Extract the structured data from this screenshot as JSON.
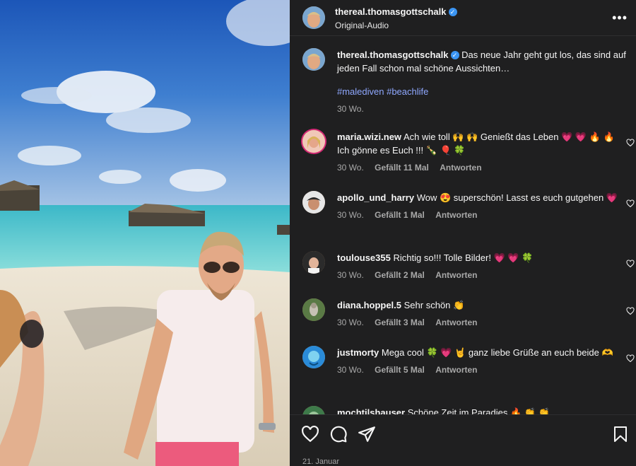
{
  "header": {
    "username": "thereal.thomasgottschalk",
    "subtitle": "Original-Audio",
    "more_label": "•••"
  },
  "caption": {
    "username": "thereal.thomasgottschalk",
    "text": "Das neue Jahr geht gut los, das sind auf jeden Fall schon mal schöne Aussichten…",
    "hashtags": "#malediven #beachlife",
    "age": "30 Wo."
  },
  "comments": [
    {
      "username": "maria.wizi.new",
      "text": "Ach wie toll 🙌 🙌  Genießt das Leben 💗 💗 🔥 🔥  Ich gönne es Euch !!! 🍾 🎈 🍀",
      "age": "30 Wo.",
      "likes": "Gefällt 11 Mal",
      "reply": "Antworten"
    },
    {
      "username": "apollo_und_harry",
      "text": "Wow 😍  superschön! Lasst es euch gutgehen 💗",
      "age": "30 Wo.",
      "likes": "Gefällt 1 Mal",
      "reply": "Antworten"
    },
    {
      "username": "toulouse355",
      "text": "Richtig so!!! Tolle Bilder! 💗 💗 🍀",
      "age": "30 Wo.",
      "likes": "Gefällt 2 Mal",
      "reply": "Antworten"
    },
    {
      "username": "diana.hoppel.5",
      "text": "Sehr schön 👏",
      "age": "30 Wo.",
      "likes": "Gefällt 3 Mal",
      "reply": "Antworten"
    },
    {
      "username": "justmorty",
      "text": "Mega cool 🍀 💗 🤘 ganz liebe Grüße an euch beide 🫶",
      "age": "30 Wo.",
      "likes": "Gefällt 5 Mal",
      "reply": "Antworten"
    },
    {
      "username": "mochtilshauser",
      "text": "Schöne Zeit im Paradies 🔥 👏 👏"
    }
  ],
  "footer": {
    "date": "21. Januar"
  },
  "colors": {
    "panel_bg": "#1f1f20",
    "hashtag": "#8fa8ff",
    "verified": "#3b95f3"
  },
  "icons": [
    "heart-icon",
    "comment-icon",
    "share-icon",
    "bookmark-icon",
    "verified-icon",
    "more-icon"
  ]
}
